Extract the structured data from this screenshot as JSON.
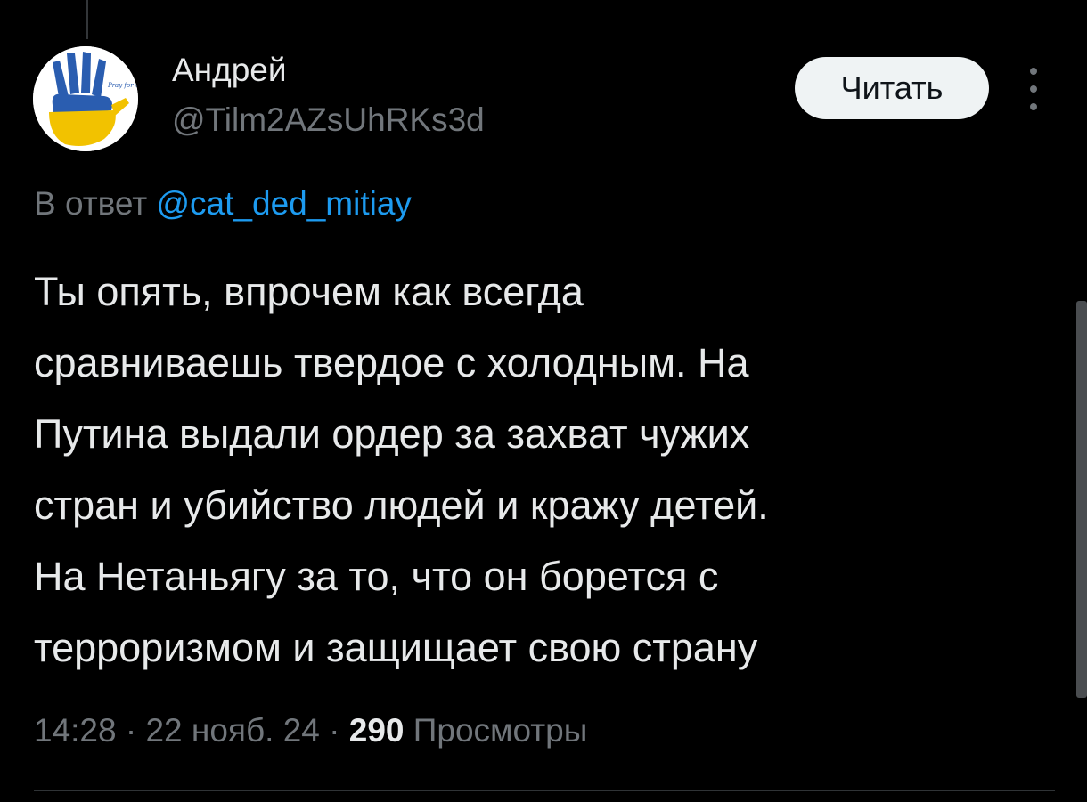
{
  "user": {
    "display_name": "Андрей",
    "handle": "@Tilm2AZsUhRKs3d",
    "avatar_text": "Pray for Ukraine"
  },
  "follow_button_label": "Читать",
  "more_icon": "more-vertical-icon",
  "reply": {
    "prefix": "В ответ",
    "mention": "@cat_ded_mitiay"
  },
  "tweet": {
    "lines": [
      "Ты опять, впрочем как всегда",
      "сравниваешь твердое с холодным. На",
      "Путина выдали ордер за захват чужих",
      "стран и убийство людей и кражу детей.",
      "На Нетаньягу за то, что он борется с",
      "терроризмом и защищает свою страну"
    ]
  },
  "meta": {
    "time": "14:28",
    "sep1": " · ",
    "date": "22 нояб. 24",
    "sep2": " · ",
    "views_count": "290",
    "views_label": " Просмотры"
  },
  "colors": {
    "background": "#000000",
    "text_primary": "#e7e9ea",
    "text_secondary": "#71767b",
    "link": "#1d9bf0",
    "button_bg": "#eff3f4",
    "avatar_blue": "#2a5db0",
    "avatar_yellow": "#f2c200"
  }
}
